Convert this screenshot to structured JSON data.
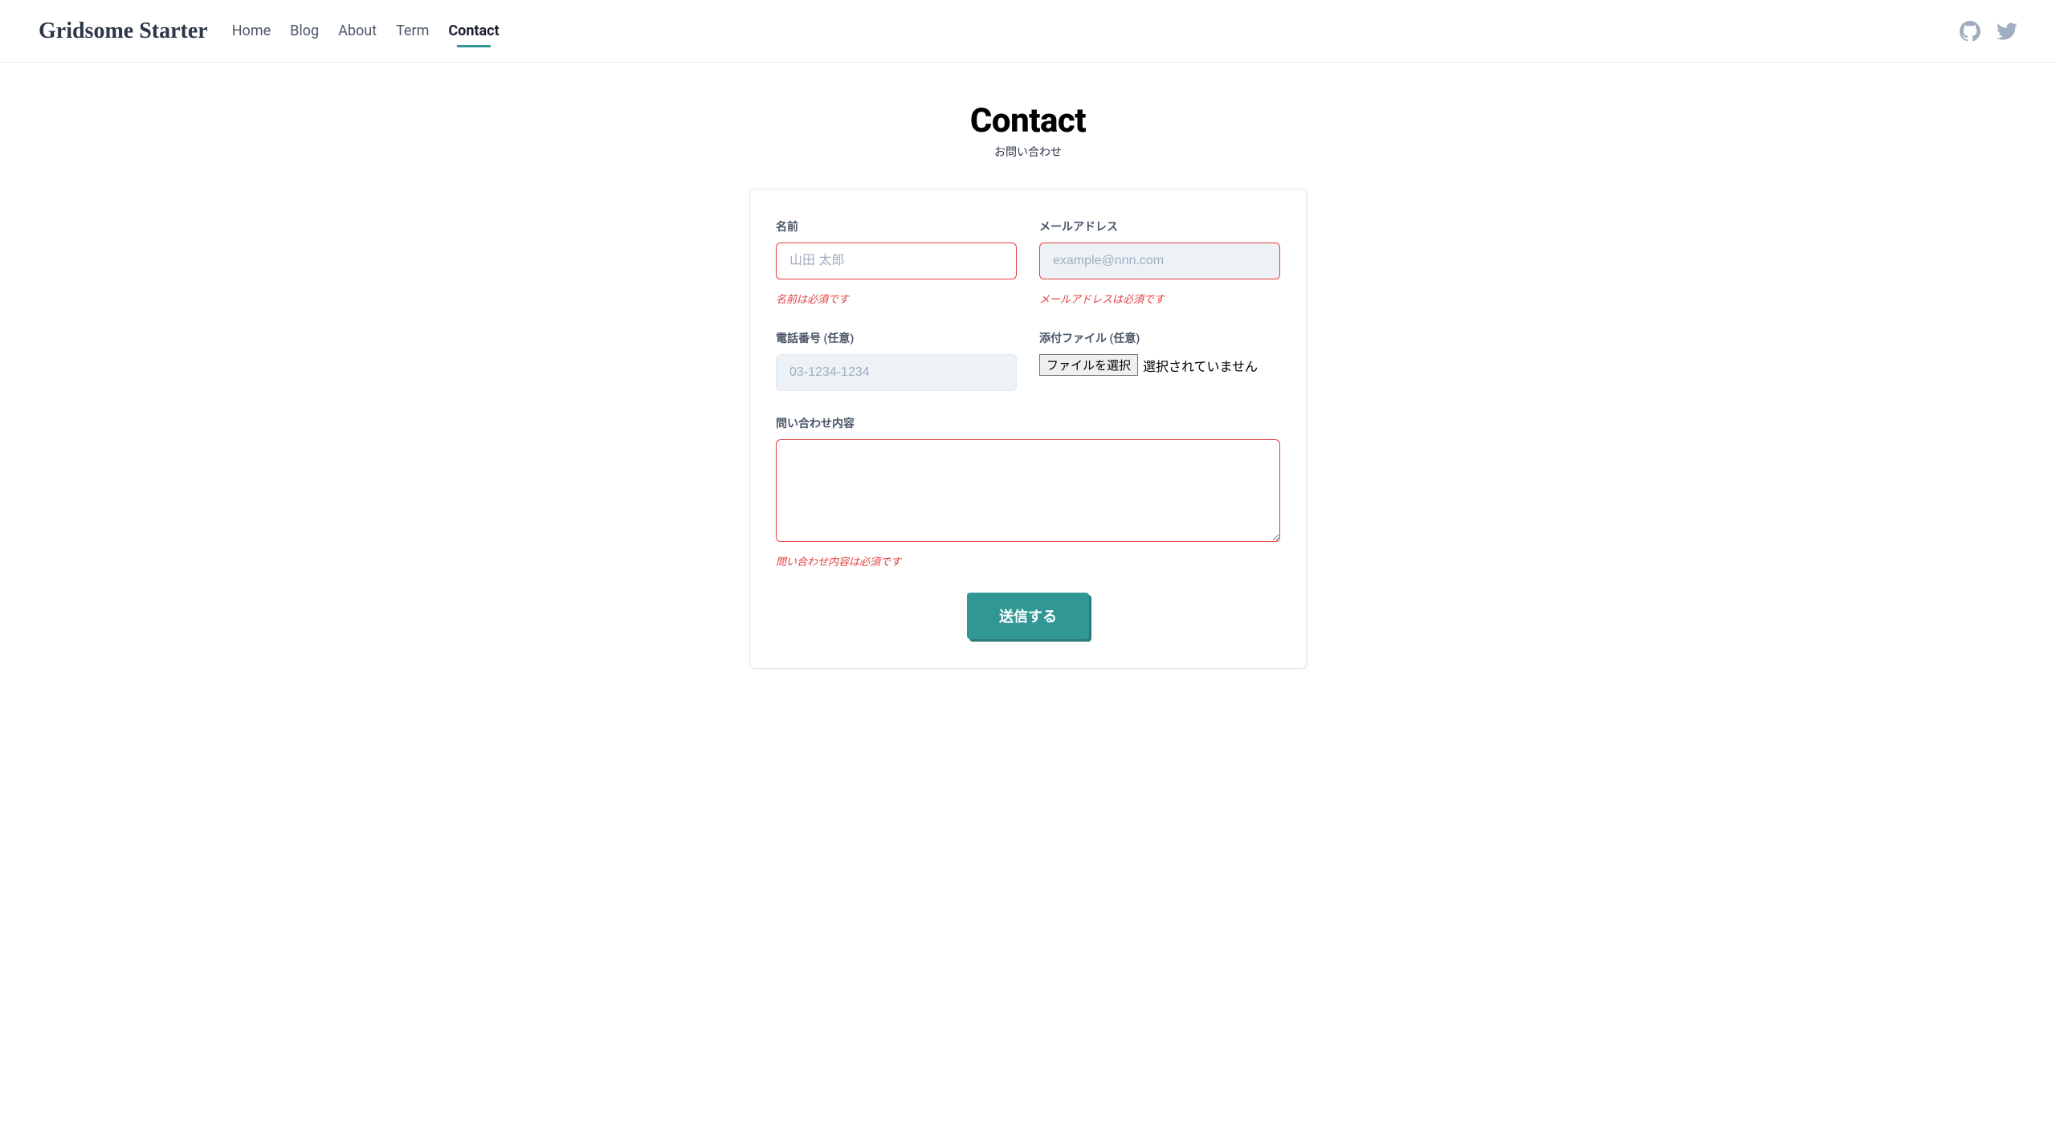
{
  "brand": "Gridsome Starter",
  "nav": [
    {
      "label": "Home",
      "active": false
    },
    {
      "label": "Blog",
      "active": false
    },
    {
      "label": "About",
      "active": false
    },
    {
      "label": "Term",
      "active": false
    },
    {
      "label": "Contact",
      "active": true
    }
  ],
  "page": {
    "title": "Contact",
    "subtitle": "お問い合わせ"
  },
  "form": {
    "name": {
      "label": "名前",
      "placeholder": "山田 太郎",
      "value": "",
      "error": "名前は必須です"
    },
    "email": {
      "label": "メールアドレス",
      "placeholder": "example@nnn.com",
      "value": "",
      "error": "メールアドレスは必須です"
    },
    "phone": {
      "label": "電話番号 (任意)",
      "placeholder": "03-1234-1234",
      "value": ""
    },
    "file": {
      "label": "添付ファイル (任意)",
      "button": "ファイルを選択",
      "status": "選択されていません"
    },
    "message": {
      "label": "問い合わせ内容",
      "value": "",
      "error": "問い合わせ内容は必須です"
    },
    "submit": "送信する"
  }
}
